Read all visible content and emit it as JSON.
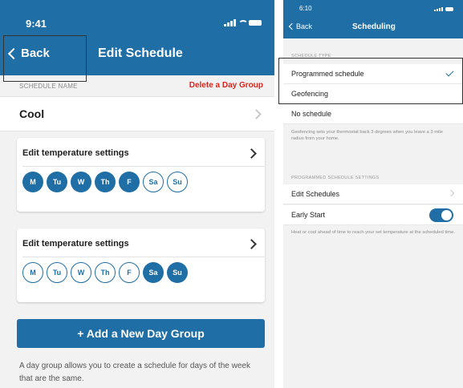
{
  "left": {
    "status_time": "9:41",
    "back_label": "Back",
    "title": "Edit Schedule",
    "section_label": "SCHEDULE NAME",
    "delete_label": "Delete a Day Group",
    "schedule_name": "Cool",
    "groups": [
      {
        "title": "Edit temperature settings",
        "days": [
          {
            "label": "M",
            "selected": true
          },
          {
            "label": "Tu",
            "selected": true
          },
          {
            "label": "W",
            "selected": true
          },
          {
            "label": "Th",
            "selected": true
          },
          {
            "label": "F",
            "selected": true
          },
          {
            "label": "Sa",
            "selected": false
          },
          {
            "label": "Su",
            "selected": false
          }
        ]
      },
      {
        "title": "Edit temperature settings",
        "days": [
          {
            "label": "M",
            "selected": false
          },
          {
            "label": "Tu",
            "selected": false
          },
          {
            "label": "W",
            "selected": false
          },
          {
            "label": "Th",
            "selected": false
          },
          {
            "label": "F",
            "selected": false
          },
          {
            "label": "Sa",
            "selected": true
          },
          {
            "label": "Su",
            "selected": true
          }
        ]
      }
    ],
    "add_button": "+ Add a New Day Group",
    "footer": "A day group allows you to create a schedule for days of the week that are the same."
  },
  "right": {
    "status_time": "6:10",
    "back_label": "Back",
    "title": "Scheduling",
    "section1_label": "SCHEDULE TYPE",
    "types": [
      {
        "label": "Programmed schedule",
        "checked": true
      },
      {
        "label": "Geofencing",
        "checked": false
      },
      {
        "label": "No schedule",
        "checked": false
      }
    ],
    "geofence_note": "Geofencing sets your thermostat back 3 degrees when you leave a 3 mile radius from your home.",
    "section2_label": "PROGRAMMED SCHEDULE SETTINGS",
    "edit_schedules": "Edit Schedules",
    "early_start": "Early Start",
    "early_start_on": true,
    "early_start_note": "Heat or cool ahead of time to reach your set temperature at the scheduled time."
  },
  "colors": {
    "primary": "#1f6ea5",
    "danger": "#d9251c"
  }
}
